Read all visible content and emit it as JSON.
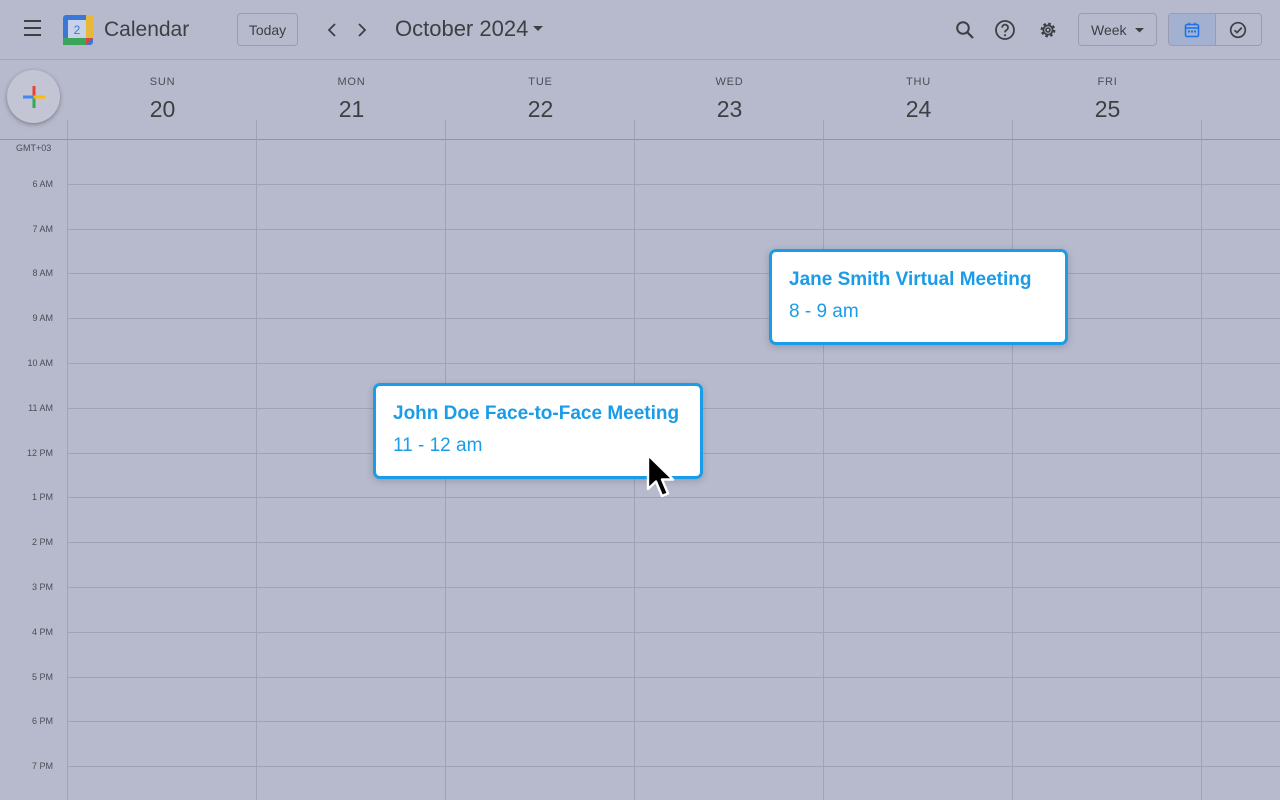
{
  "header": {
    "app_title": "Calendar",
    "logo_day": "2",
    "today_label": "Today",
    "date_title": "October 2024",
    "view_label": "Week"
  },
  "days": [
    {
      "name": "SUN",
      "num": "20"
    },
    {
      "name": "MON",
      "num": "21"
    },
    {
      "name": "TUE",
      "num": "22"
    },
    {
      "name": "WED",
      "num": "23"
    },
    {
      "name": "THU",
      "num": "24"
    },
    {
      "name": "FRI",
      "num": "25"
    }
  ],
  "timezone": "GMT+03",
  "hours": [
    "6 AM",
    "7 AM",
    "8 AM",
    "9 AM",
    "10 AM",
    "11 AM",
    "12 PM",
    "1 PM",
    "2 PM",
    "3 PM",
    "4 PM",
    "5 PM",
    "6 PM",
    "7 PM"
  ],
  "events": [
    {
      "title": "Jane Smith Virtual Meeting",
      "time": "8 - 9 am"
    },
    {
      "title": "John Doe Face-to-Face Meeting",
      "time": "11 - 12 am"
    }
  ],
  "colors": {
    "event_accent": "#1a9ce8",
    "background": "#b7bacd"
  }
}
